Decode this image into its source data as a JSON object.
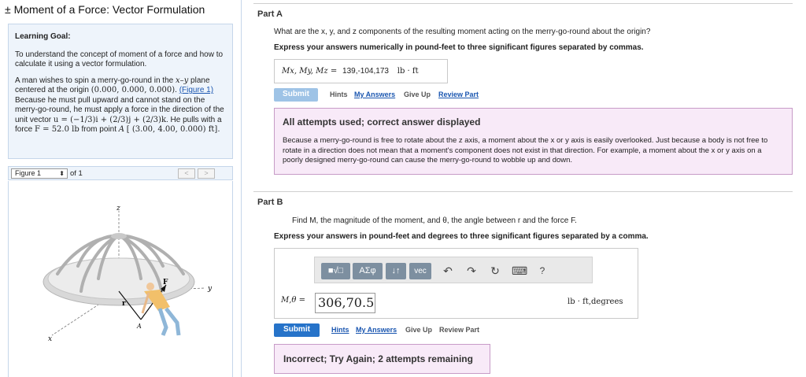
{
  "page": {
    "title": "± Moment of a Force: Vector Formulation"
  },
  "left_panel": {
    "goal_heading": "Learning Goal:",
    "goal_text": "To understand the concept of moment of a force and how to calculate it using a vector formulation.",
    "problem": {
      "t1": "A man wishes to spin a merry-go-round in the ",
      "t1_math": "x–y",
      "t2": " plane centered at the origin ",
      "origin": "(0.000, 0.000, 0.000)",
      "t3": ". ",
      "figure_link": "(Figure 1)",
      "t4": " Because he must pull upward and cannot stand on the merry-go-round, he must apply a force in the direction of the unit vector ",
      "unit_vector": "u = (−1/3)i + (2/3)j + (2/3)k",
      "t5": ". He pulls with a force ",
      "force": "F = 52.0 lb",
      "t6": " from point ",
      "point_name": "A",
      "point_coords": "[ (3.00, 4.00, 0.000) ft]."
    },
    "figure_nav": {
      "selected": "Figure 1",
      "of_text": "of 1",
      "prev": "<",
      "next": ">"
    },
    "figure_labels": {
      "z": "z",
      "y": "y",
      "x": "x",
      "F": "F",
      "r": "r",
      "A": "A"
    }
  },
  "part_a": {
    "label": "Part A",
    "question": "What are the x, y, and z components of the resulting moment acting on the merry-go-round about the origin?",
    "instruction": "Express your answers numerically in pound-feet to three significant figures separated by commas.",
    "answer_label": "Mx, My, Mz =",
    "answer_value": "139,-104,173",
    "answer_unit": "lb · ft",
    "submit": "Submit",
    "hints": "Hints",
    "my_answers": "My Answers",
    "give_up": "Give Up",
    "review_part": "Review Part",
    "feedback_title": "All attempts used; correct answer displayed",
    "feedback_body": "Because a merry-go-round is free to rotate about the z axis, a moment about the x or y axis is easily overlooked. Just because a body is not free to rotate in a direction does not mean that a moment's component does not exist in that direction. For example, a moment about the x or y axis on a poorly designed merry-go-round can cause the merry-go-round to wobble up and down."
  },
  "part_b": {
    "label": "Part B",
    "question": "Find M, the magnitude of the moment, and θ, the angle between r and the force F.",
    "instruction": "Express your answers in pound-feet and degrees to three significant figures separated by a comma.",
    "toolbar": {
      "templates": "■√□",
      "greek": "ΑΣφ",
      "arrows": "↓↑",
      "vec": "vec",
      "undo": "↶",
      "redo": "↷",
      "reset": "↻",
      "keyboard": "⌨",
      "help": "?"
    },
    "answer_label": "M,θ =",
    "answer_value": "306,70.5",
    "answer_unit": "lb · ft,degrees",
    "submit": "Submit",
    "hints": "Hints",
    "my_answers": "My Answers",
    "give_up": "Give Up",
    "review_part": "Review Part",
    "feedback": "Incorrect; Try Again; 2 attempts remaining"
  }
}
